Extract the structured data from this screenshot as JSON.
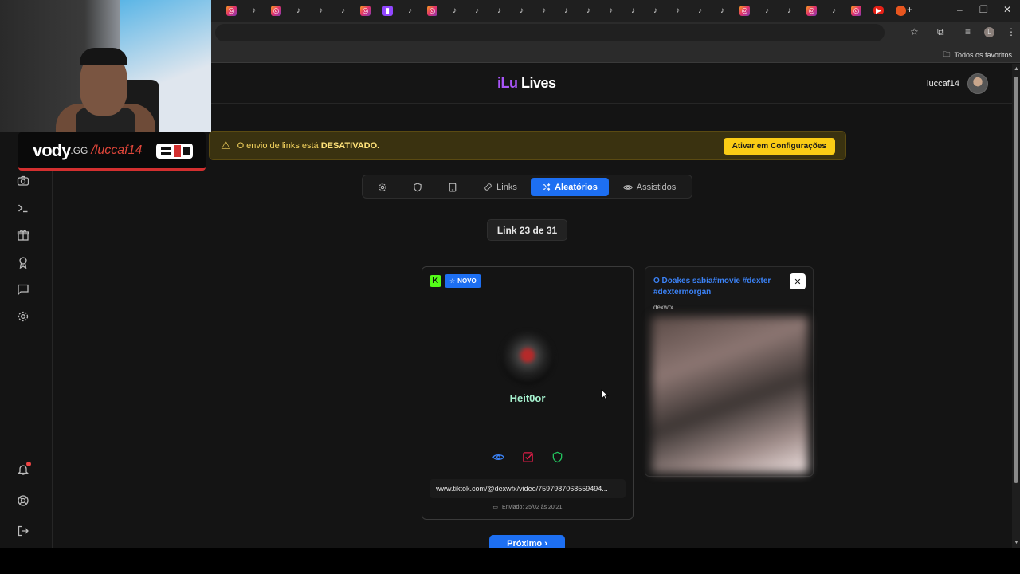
{
  "browser": {
    "tab_favicons": [
      "instagram",
      "tiktok",
      "instagram",
      "tiktok",
      "tiktok",
      "tiktok",
      "instagram",
      "twitch",
      "tiktok",
      "instagram",
      "tiktok",
      "tiktok",
      "tiktok",
      "tiktok",
      "tiktok",
      "tiktok",
      "tiktok",
      "tiktok",
      "tiktok",
      "tiktok",
      "tiktok",
      "tiktok",
      "tiktok",
      "instagram",
      "tiktok",
      "tiktok",
      "instagram",
      "tiktok",
      "instagram",
      "youtube",
      "orange-app"
    ],
    "bookmarks_label": "Todos os favoritos"
  },
  "app": {
    "brand_part1": "iLu",
    "brand_part2": "Lives",
    "username": "luccaf14"
  },
  "banner": {
    "text": "O envio de links está",
    "status": "DESATIVADO.",
    "button_label": "Ativar em Configurações"
  },
  "tabs": [
    {
      "icon": "gear-icon",
      "label": ""
    },
    {
      "icon": "shield-icon",
      "label": ""
    },
    {
      "icon": "tablet-icon",
      "label": ""
    },
    {
      "icon": "link-icon",
      "label": "Links"
    },
    {
      "icon": "shuffle-icon",
      "label": "Aleatórios",
      "active": true
    },
    {
      "icon": "eye-icon",
      "label": "Assistidos"
    }
  ],
  "counter": "Link 23 de 31",
  "card": {
    "badge_label": "NOVO",
    "platform_letter": "K",
    "profile_name": "Heit0or",
    "url": "www.tiktok.com/@dexwfx/video/7597987068559494...",
    "sent": "Enviado: 25/02 às 20:21"
  },
  "preview": {
    "title": "O Doakes sabia#movie #dexter #dextermorgan",
    "author": "dexwfx"
  },
  "next_button": "Próximo ›",
  "overlay": {
    "logo": "vody",
    "logo_suffix": ".GG",
    "handle": "/luccaf14"
  },
  "colors": {
    "accent": "#1d6ff2",
    "brand_purple": "#a855f7",
    "warning_yellow": "#facc15",
    "profile_name": "#a7f3d0",
    "kick_green": "#53fc18"
  }
}
